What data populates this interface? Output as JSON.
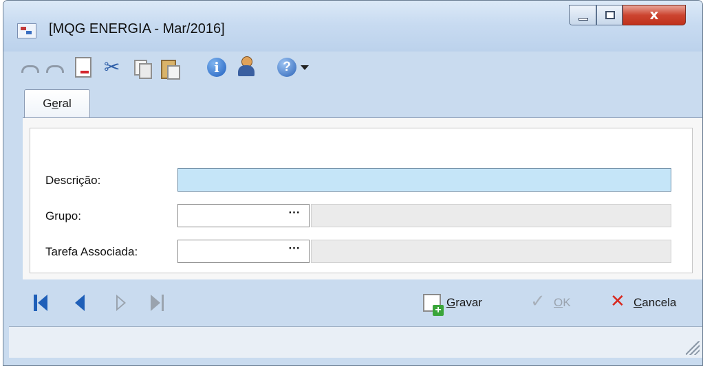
{
  "window": {
    "title": "[MQG ENERGIA - Mar/2016]",
    "close_glyph": "x"
  },
  "toolbar": {
    "items": [
      "undo-icon",
      "redo-icon",
      "new-document-icon",
      "cut-icon",
      "copy-icon",
      "paste-icon",
      "info-icon",
      "user-icon",
      "help-icon"
    ],
    "info_glyph": "i",
    "help_glyph": "?"
  },
  "tabs": [
    {
      "label_pre": "G",
      "label_underlined": "e",
      "label_post": "ral"
    }
  ],
  "form": {
    "descricao": {
      "label": "Descrição:",
      "value": ""
    },
    "grupo": {
      "label": "Grupo:",
      "code": "",
      "name": "",
      "button": "···"
    },
    "tarefa": {
      "label": "Tarefa Associada:",
      "code": "",
      "name": "",
      "button": "···"
    }
  },
  "actions": {
    "gravar": {
      "underlined": "G",
      "rest": "ravar"
    },
    "ok": {
      "underlined": "O",
      "rest": "K"
    },
    "cancela": {
      "underlined": "C",
      "rest": "ancela"
    }
  },
  "colors": {
    "chrome": "#c9dbef",
    "focused_field": "#c5e5f8",
    "nav_active": "#1f5fb8",
    "nav_disabled": "#9aa3ae",
    "cancel": "#d8281e",
    "add": "#3aa53a"
  }
}
